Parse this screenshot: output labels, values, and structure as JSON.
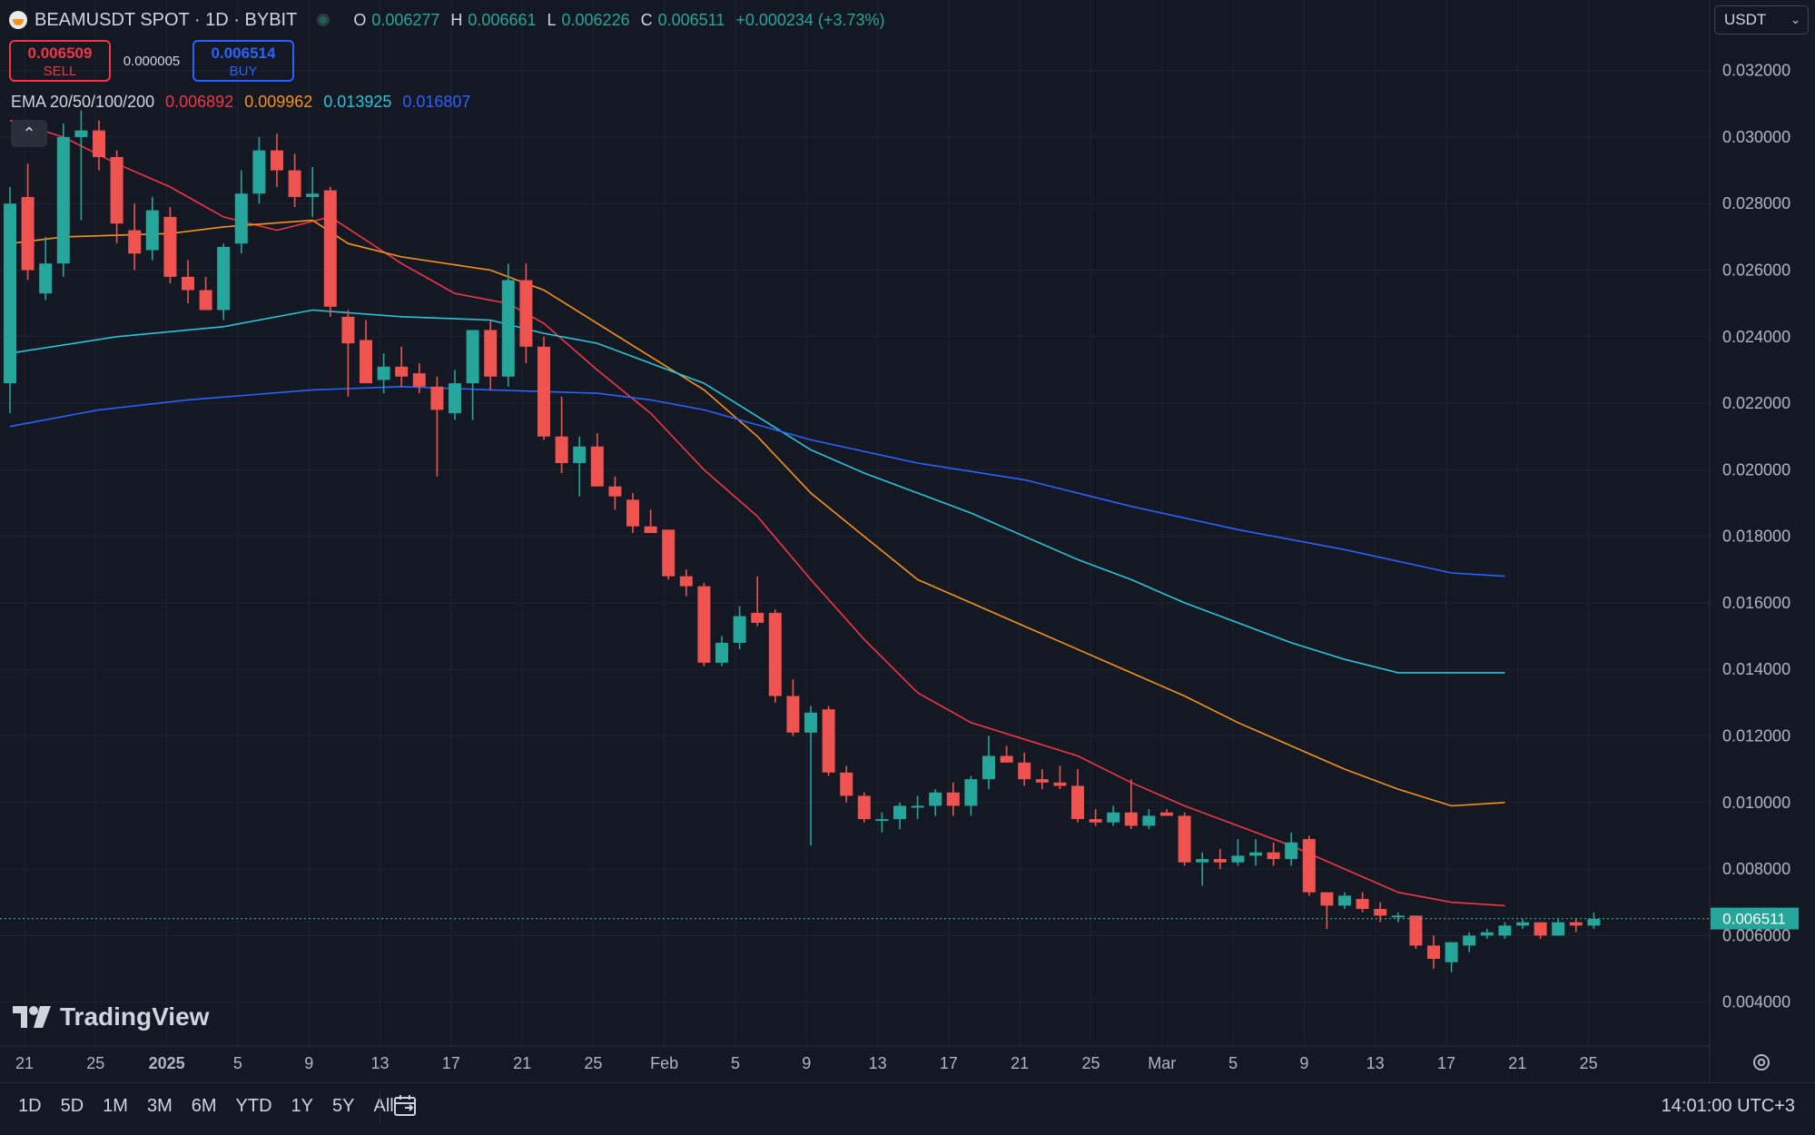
{
  "header": {
    "symbol_title": "BEAMUSDT SPOT · 1D · BYBIT",
    "ohlc": [
      {
        "key": "O",
        "value": "0.006277"
      },
      {
        "key": "H",
        "value": "0.006661"
      },
      {
        "key": "L",
        "value": "0.006226"
      },
      {
        "key": "C",
        "value": "0.006511"
      }
    ],
    "change": "+0.000234 (+3.73%)"
  },
  "trade": {
    "sell_price": "0.006509",
    "sell_label": "SELL",
    "spread": "0.000005",
    "buy_price": "0.006514",
    "buy_label": "BUY"
  },
  "indicator": {
    "name": "EMA 20/50/100/200",
    "values": [
      "0.006892",
      "0.009962",
      "0.013925",
      "0.016807"
    ],
    "colors": [
      "#f23645",
      "#f7931a",
      "#26c6da",
      "#2962ff"
    ]
  },
  "currency_select": {
    "value": "USDT"
  },
  "branding": {
    "logo_text": "TradingView"
  },
  "bottom_bar": {
    "ranges": [
      "1D",
      "5D",
      "1M",
      "3M",
      "6M",
      "YTD",
      "1Y",
      "5Y",
      "All"
    ],
    "clock": "14:01:00 UTC+3"
  },
  "chart_data": {
    "type": "candlestick",
    "title": "",
    "price_axis_ticks": [
      "0.032000",
      "0.030000",
      "0.028000",
      "0.026000",
      "0.024000",
      "0.022000",
      "0.020000",
      "0.018000",
      "0.016000",
      "0.014000",
      "0.012000",
      "0.010000",
      "0.008000",
      "0.006000",
      "0.004000"
    ],
    "ylim": [
      0.00268,
      0.03412
    ],
    "time_axis_ticks": [
      "21",
      "25",
      "2025",
      "5",
      "9",
      "13",
      "17",
      "21",
      "25",
      "Feb",
      "5",
      "9",
      "13",
      "17",
      "21",
      "25",
      "Mar",
      "5",
      "9",
      "13",
      "17",
      "21",
      "25"
    ],
    "last_price": "0.006511",
    "colors": {
      "up": "#26a69a",
      "down": "#ef5350",
      "background": "#141823",
      "grid": "#1f2331"
    },
    "series": [
      {
        "name": "EMA 20",
        "color": "#f23645",
        "points": [
          [
            0,
            0.0305
          ],
          [
            3,
            0.03
          ],
          [
            6,
            0.0292
          ],
          [
            9,
            0.0285
          ],
          [
            12,
            0.0276
          ],
          [
            15,
            0.0272
          ],
          [
            18,
            0.0276
          ],
          [
            20,
            0.0269
          ],
          [
            22,
            0.0262
          ],
          [
            25,
            0.0253
          ],
          [
            28,
            0.025
          ],
          [
            30,
            0.0244
          ],
          [
            33,
            0.023
          ],
          [
            36,
            0.0217
          ],
          [
            39,
            0.02
          ],
          [
            42,
            0.0186
          ],
          [
            45,
            0.0167
          ],
          [
            48,
            0.0149
          ],
          [
            51,
            0.0133
          ],
          [
            54,
            0.0124
          ],
          [
            57,
            0.0119
          ],
          [
            60,
            0.0114
          ],
          [
            63,
            0.0106
          ],
          [
            66,
            0.0099
          ],
          [
            69,
            0.0093
          ],
          [
            72,
            0.0087
          ],
          [
            75,
            0.008
          ],
          [
            78,
            0.0073
          ],
          [
            81,
            0.007
          ],
          [
            84,
            0.0069
          ]
        ]
      },
      {
        "name": "EMA 50",
        "color": "#f7931a",
        "points": [
          [
            0,
            0.0268
          ],
          [
            3,
            0.027
          ],
          [
            9,
            0.0271
          ],
          [
            12,
            0.0273
          ],
          [
            17,
            0.0275
          ],
          [
            19,
            0.0268
          ],
          [
            22,
            0.0264
          ],
          [
            27,
            0.026
          ],
          [
            30,
            0.0254
          ],
          [
            33,
            0.0244
          ],
          [
            36,
            0.0234
          ],
          [
            39,
            0.0224
          ],
          [
            42,
            0.021
          ],
          [
            45,
            0.0193
          ],
          [
            48,
            0.018
          ],
          [
            51,
            0.0167
          ],
          [
            54,
            0.016
          ],
          [
            57,
            0.0153
          ],
          [
            60,
            0.0146
          ],
          [
            63,
            0.0139
          ],
          [
            66,
            0.0132
          ],
          [
            69,
            0.0124
          ],
          [
            72,
            0.0117
          ],
          [
            75,
            0.011
          ],
          [
            78,
            0.0104
          ],
          [
            81,
            0.0099
          ],
          [
            84,
            0.01
          ]
        ]
      },
      {
        "name": "EMA 100",
        "color": "#26c6da",
        "points": [
          [
            0,
            0.0235
          ],
          [
            6,
            0.024
          ],
          [
            12,
            0.0243
          ],
          [
            17,
            0.0248
          ],
          [
            22,
            0.0246
          ],
          [
            27,
            0.0245
          ],
          [
            30,
            0.0241
          ],
          [
            33,
            0.0238
          ],
          [
            36,
            0.0232
          ],
          [
            39,
            0.0226
          ],
          [
            42,
            0.0216
          ],
          [
            45,
            0.0206
          ],
          [
            48,
            0.0199
          ],
          [
            51,
            0.0193
          ],
          [
            54,
            0.0187
          ],
          [
            57,
            0.018
          ],
          [
            60,
            0.0173
          ],
          [
            63,
            0.0167
          ],
          [
            66,
            0.016
          ],
          [
            69,
            0.0154
          ],
          [
            72,
            0.0148
          ],
          [
            75,
            0.0143
          ],
          [
            78,
            0.0139
          ],
          [
            84,
            0.0139
          ]
        ]
      },
      {
        "name": "EMA 200",
        "color": "#2962ff",
        "points": [
          [
            0,
            0.0213
          ],
          [
            5,
            0.0218
          ],
          [
            10,
            0.0221
          ],
          [
            17,
            0.0224
          ],
          [
            22,
            0.0225
          ],
          [
            27,
            0.0224
          ],
          [
            33,
            0.0223
          ],
          [
            36,
            0.0221
          ],
          [
            39,
            0.0218
          ],
          [
            45,
            0.0209
          ],
          [
            51,
            0.0202
          ],
          [
            57,
            0.0197
          ],
          [
            63,
            0.0189
          ],
          [
            69,
            0.0182
          ],
          [
            75,
            0.0176
          ],
          [
            81,
            0.0169
          ],
          [
            84,
            0.0168
          ]
        ]
      }
    ],
    "candles": [
      [
        0.0226,
        0.0285,
        0.0217,
        0.028
      ],
      [
        0.0282,
        0.0292,
        0.0257,
        0.026
      ],
      [
        0.0253,
        0.027,
        0.0251,
        0.0262
      ],
      [
        0.0262,
        0.0304,
        0.0258,
        0.03
      ],
      [
        0.03,
        0.0308,
        0.0275,
        0.0302
      ],
      [
        0.0302,
        0.0305,
        0.029,
        0.0294
      ],
      [
        0.0294,
        0.0296,
        0.0268,
        0.0274
      ],
      [
        0.0272,
        0.028,
        0.026,
        0.0265
      ],
      [
        0.0266,
        0.0282,
        0.0263,
        0.0278
      ],
      [
        0.0276,
        0.0279,
        0.0256,
        0.0258
      ],
      [
        0.0258,
        0.0263,
        0.025,
        0.0254
      ],
      [
        0.0254,
        0.0258,
        0.0248,
        0.0248
      ],
      [
        0.0248,
        0.0268,
        0.0245,
        0.0267
      ],
      [
        0.0268,
        0.029,
        0.0265,
        0.0283
      ],
      [
        0.0283,
        0.03,
        0.028,
        0.0296
      ],
      [
        0.0296,
        0.0301,
        0.0285,
        0.029
      ],
      [
        0.029,
        0.0295,
        0.0279,
        0.0282
      ],
      [
        0.0282,
        0.0291,
        0.0276,
        0.0283
      ],
      [
        0.0284,
        0.0285,
        0.0246,
        0.0249
      ],
      [
        0.0246,
        0.0248,
        0.0222,
        0.0238
      ],
      [
        0.0239,
        0.0245,
        0.0226,
        0.0226
      ],
      [
        0.0227,
        0.0235,
        0.0223,
        0.0231
      ],
      [
        0.0231,
        0.0237,
        0.0225,
        0.0228
      ],
      [
        0.0229,
        0.0232,
        0.0223,
        0.0225
      ],
      [
        0.0225,
        0.0228,
        0.0198,
        0.0218
      ],
      [
        0.0217,
        0.023,
        0.0215,
        0.0226
      ],
      [
        0.0226,
        0.0242,
        0.0215,
        0.0242
      ],
      [
        0.0242,
        0.0245,
        0.0224,
        0.0228
      ],
      [
        0.0228,
        0.0262,
        0.0225,
        0.0257
      ],
      [
        0.0257,
        0.0262,
        0.0232,
        0.0237
      ],
      [
        0.0237,
        0.024,
        0.0209,
        0.021
      ],
      [
        0.021,
        0.0222,
        0.0199,
        0.0202
      ],
      [
        0.0202,
        0.021,
        0.0192,
        0.0207
      ],
      [
        0.0207,
        0.0211,
        0.0195,
        0.0195
      ],
      [
        0.0195,
        0.0198,
        0.0188,
        0.0192
      ],
      [
        0.0191,
        0.0193,
        0.0181,
        0.0183
      ],
      [
        0.0183,
        0.0188,
        0.0181,
        0.0181
      ],
      [
        0.0182,
        0.0182,
        0.0167,
        0.0168
      ],
      [
        0.0168,
        0.017,
        0.0162,
        0.0165
      ],
      [
        0.0165,
        0.0166,
        0.0141,
        0.0142
      ],
      [
        0.0142,
        0.015,
        0.0141,
        0.0148
      ],
      [
        0.0148,
        0.0159,
        0.0146,
        0.0156
      ],
      [
        0.0157,
        0.0168,
        0.0153,
        0.0154
      ],
      [
        0.0157,
        0.0158,
        0.013,
        0.0132
      ],
      [
        0.0132,
        0.0137,
        0.012,
        0.0121
      ],
      [
        0.0121,
        0.0129,
        0.0087,
        0.0127
      ],
      [
        0.0128,
        0.0129,
        0.0108,
        0.0109
      ],
      [
        0.0109,
        0.0111,
        0.01,
        0.0102
      ],
      [
        0.0102,
        0.0103,
        0.0094,
        0.0095
      ],
      [
        0.0095,
        0.0097,
        0.0091,
        0.0095
      ],
      [
        0.0095,
        0.01,
        0.0092,
        0.0099
      ],
      [
        0.0099,
        0.0102,
        0.0095,
        0.0099
      ],
      [
        0.0099,
        0.0104,
        0.0096,
        0.0103
      ],
      [
        0.0103,
        0.0106,
        0.0096,
        0.0099
      ],
      [
        0.0099,
        0.0108,
        0.0096,
        0.0107
      ],
      [
        0.0107,
        0.012,
        0.0104,
        0.0114
      ],
      [
        0.0114,
        0.0117,
        0.0112,
        0.0112
      ],
      [
        0.0112,
        0.0115,
        0.0105,
        0.0107
      ],
      [
        0.0107,
        0.011,
        0.0104,
        0.0106
      ],
      [
        0.0106,
        0.0111,
        0.0104,
        0.0105
      ],
      [
        0.0105,
        0.011,
        0.0094,
        0.0095
      ],
      [
        0.0095,
        0.0098,
        0.0093,
        0.0094
      ],
      [
        0.0094,
        0.0099,
        0.0093,
        0.0097
      ],
      [
        0.0097,
        0.0107,
        0.0092,
        0.0093
      ],
      [
        0.0093,
        0.0098,
        0.0092,
        0.0096
      ],
      [
        0.0097,
        0.0098,
        0.0096,
        0.0096
      ],
      [
        0.0096,
        0.0097,
        0.0081,
        0.0082
      ],
      [
        0.0082,
        0.0085,
        0.0075,
        0.0083
      ],
      [
        0.0083,
        0.0086,
        0.008,
        0.0082
      ],
      [
        0.0082,
        0.0089,
        0.0081,
        0.0084
      ],
      [
        0.0084,
        0.0089,
        0.0081,
        0.0085
      ],
      [
        0.0085,
        0.0088,
        0.0081,
        0.0083
      ],
      [
        0.0083,
        0.0091,
        0.0081,
        0.0088
      ],
      [
        0.0089,
        0.009,
        0.0072,
        0.0073
      ],
      [
        0.0073,
        0.0073,
        0.0062,
        0.0069
      ],
      [
        0.0069,
        0.0073,
        0.0068,
        0.0072
      ],
      [
        0.0071,
        0.0073,
        0.0067,
        0.0068
      ],
      [
        0.0068,
        0.007,
        0.0064,
        0.0066
      ],
      [
        0.0066,
        0.0067,
        0.0064,
        0.0066
      ],
      [
        0.0066,
        0.0066,
        0.0056,
        0.0057
      ],
      [
        0.0057,
        0.006,
        0.005,
        0.0053
      ],
      [
        0.0052,
        0.0058,
        0.0049,
        0.0058
      ],
      [
        0.0057,
        0.0061,
        0.0055,
        0.006
      ],
      [
        0.006,
        0.0062,
        0.0059,
        0.0061
      ],
      [
        0.006,
        0.0064,
        0.0059,
        0.0063
      ],
      [
        0.0063,
        0.0065,
        0.0062,
        0.0064
      ],
      [
        0.0064,
        0.0064,
        0.0059,
        0.006
      ],
      [
        0.006,
        0.0065,
        0.006,
        0.0064
      ],
      [
        0.0064,
        0.0065,
        0.0061,
        0.0063
      ],
      [
        0.0063,
        0.0067,
        0.0062,
        0.0065
      ]
    ]
  }
}
